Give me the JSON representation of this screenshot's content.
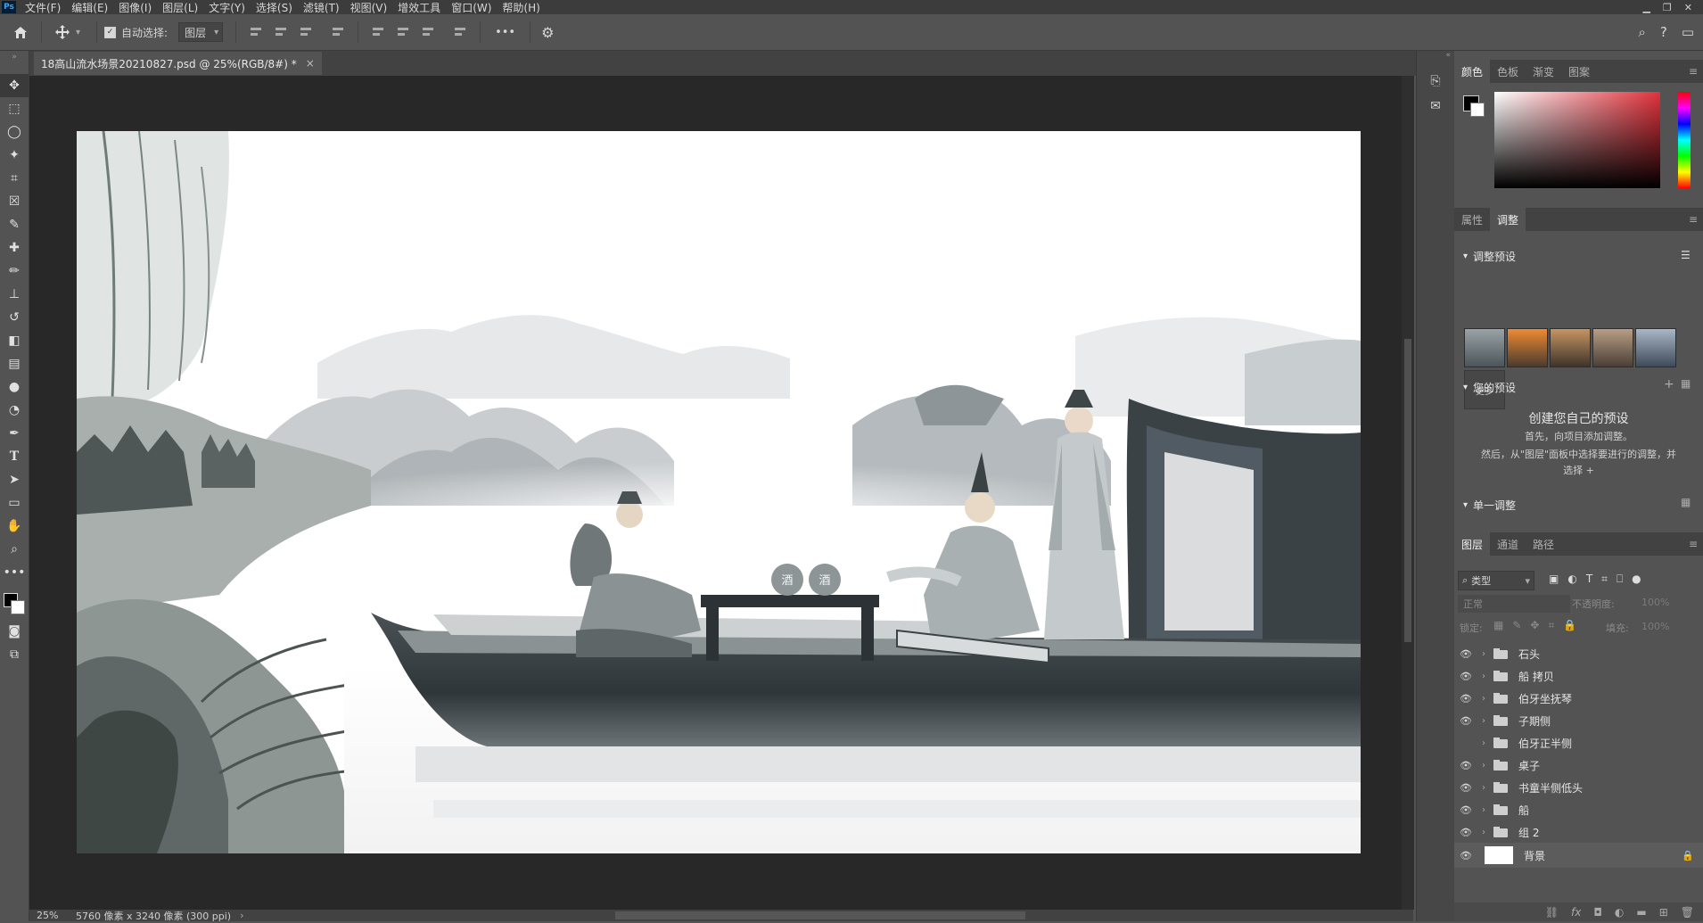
{
  "app": {
    "logo": "Ps"
  },
  "menubar": {
    "items": [
      "文件(F)",
      "编辑(E)",
      "图像(I)",
      "图层(L)",
      "文字(Y)",
      "选择(S)",
      "滤镜(T)",
      "视图(V)",
      "增效工具",
      "窗口(W)",
      "帮助(H)"
    ]
  },
  "options": {
    "auto_select_label": "自动选择:",
    "auto_select_target": "图层",
    "more_glyph": "•••"
  },
  "document": {
    "tab_title": "18高山流水场景20210827.psd @ 25%(RGB/8#) *"
  },
  "status": {
    "zoom": "25%",
    "dims": "5760 像素 x 3240 像素 (300 ppi)"
  },
  "color_panel": {
    "tabs": [
      "颜色",
      "色板",
      "渐变",
      "图案"
    ],
    "active_tab": "颜色",
    "hue_color": "#e2323c"
  },
  "adjust_panel": {
    "tabs": [
      "属性",
      "调整"
    ],
    "active_tab": "调整",
    "presets_header": "调整预设",
    "more_label": "更多",
    "your_presets_header": "您的预设",
    "create_title": "创建您自己的预设",
    "create_line1": "首先，向项目添加调整。",
    "create_line2": "然后，从\"图层\"面板中选择要进行的调整，并",
    "create_line3": "选择",
    "single_adjust_header": "单一调整"
  },
  "layers_panel": {
    "tabs": [
      "图层",
      "通道",
      "路径"
    ],
    "active_tab": "图层",
    "filter_kind": "类型",
    "blend_mode": "正常",
    "opacity_label": "不透明度:",
    "opacity_value": "100%",
    "lock_label": "锁定:",
    "fill_label": "填充:",
    "fill_value": "100%",
    "layers": [
      {
        "name": "石头",
        "visible": true,
        "type": "group"
      },
      {
        "name": "船 拷贝",
        "visible": true,
        "type": "group"
      },
      {
        "name": "伯牙坐抚琴",
        "visible": true,
        "type": "group"
      },
      {
        "name": "子期侧",
        "visible": true,
        "type": "group"
      },
      {
        "name": "伯牙正半侧",
        "visible": false,
        "type": "group"
      },
      {
        "name": "桌子",
        "visible": true,
        "type": "group"
      },
      {
        "name": "书童半侧低头",
        "visible": true,
        "type": "group"
      },
      {
        "name": "船",
        "visible": true,
        "type": "group"
      },
      {
        "name": "组 2",
        "visible": true,
        "type": "group"
      },
      {
        "name": "背景",
        "visible": true,
        "type": "background"
      }
    ]
  },
  "artwork": {
    "jar_label": "酒"
  }
}
